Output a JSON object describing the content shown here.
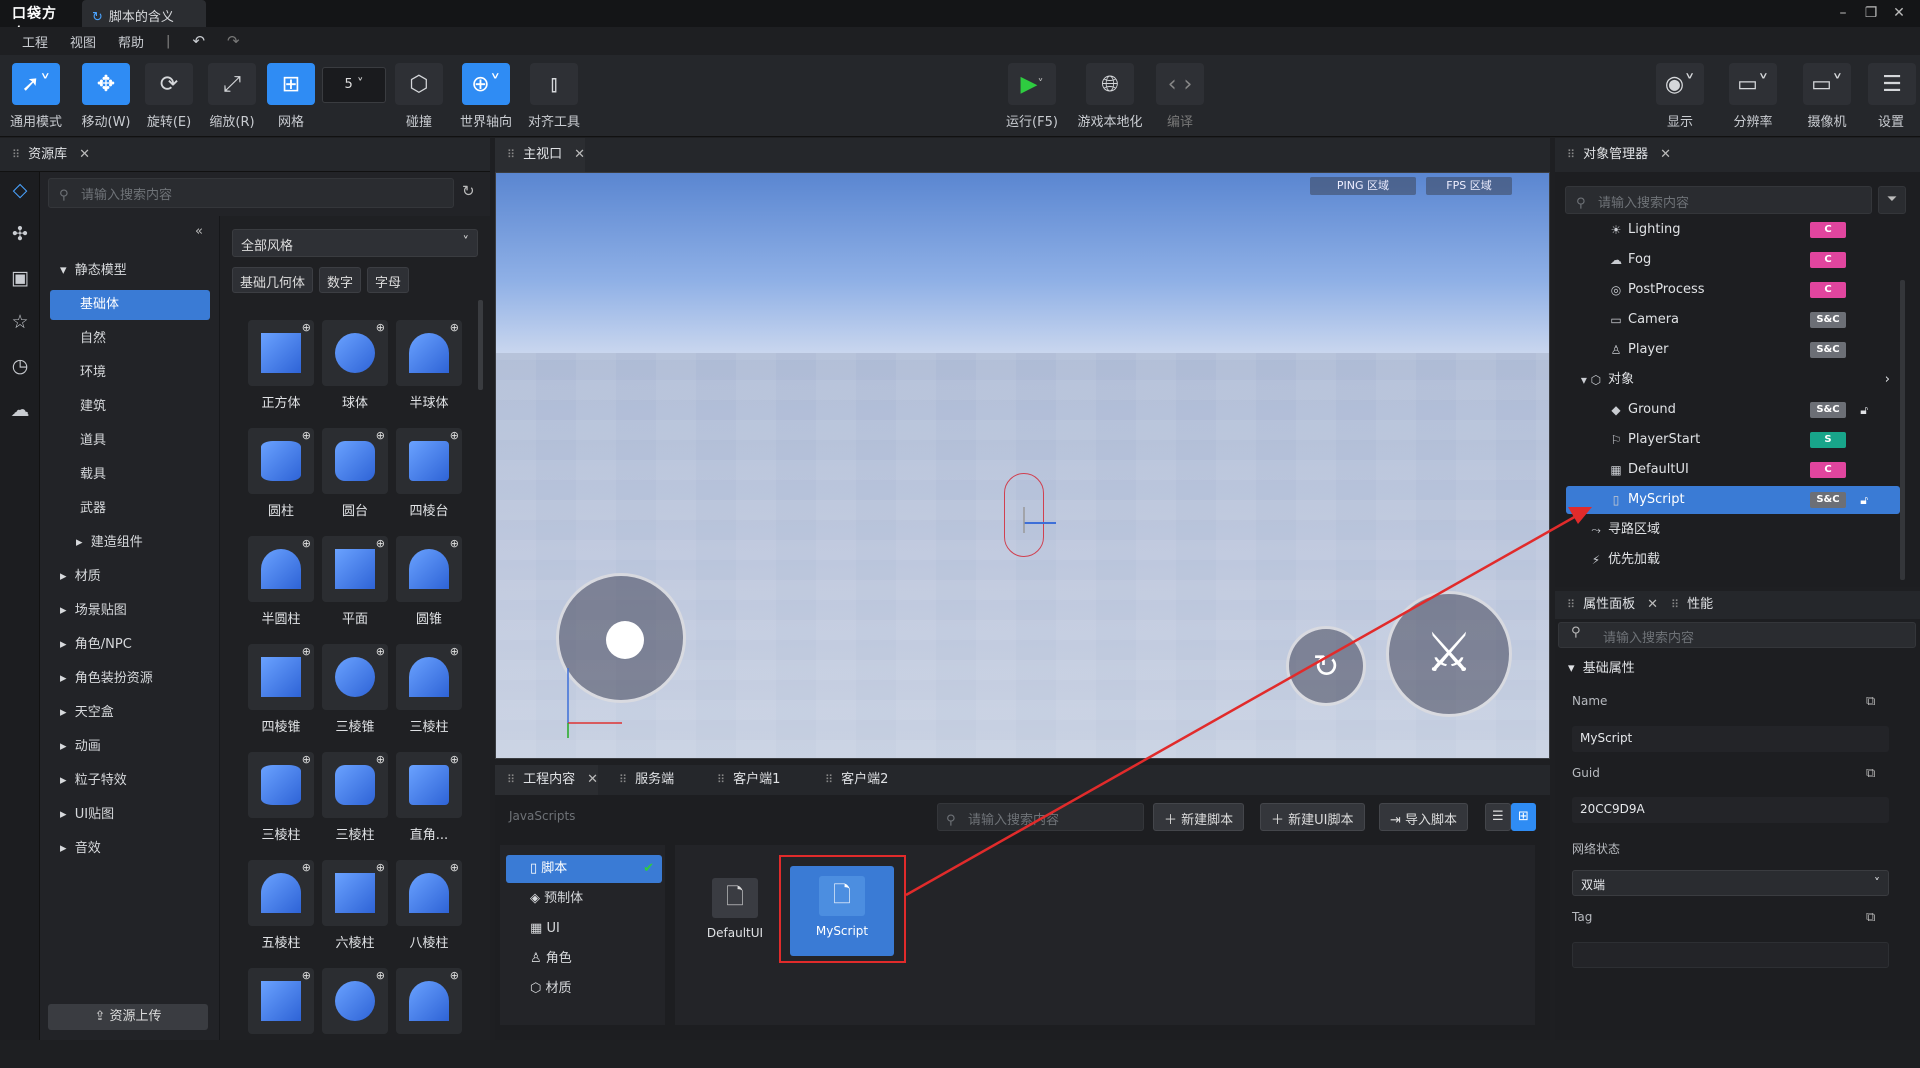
{
  "titlebar": {
    "logo": "口袋方舟",
    "tab_title": "脚本的含义"
  },
  "menu": [
    "工程",
    "视图",
    "帮助"
  ],
  "toolbar": {
    "left": [
      {
        "label": "通用模式"
      },
      {
        "label": "移动(W)"
      },
      {
        "label": "旋转(E)"
      },
      {
        "label": "缩放(R)"
      },
      {
        "label": "网格"
      },
      {
        "label": "碰撞"
      },
      {
        "label": "世界轴向"
      },
      {
        "label": "对齐工具"
      }
    ],
    "grid_size": "5",
    "center": [
      {
        "label": "运行(F5)"
      },
      {
        "label": "游戏本地化"
      },
      {
        "label": "编译"
      }
    ],
    "right": [
      {
        "label": "显示"
      },
      {
        "label": "分辨率"
      },
      {
        "label": "摄像机"
      },
      {
        "label": "设置"
      }
    ]
  },
  "asset_panel": {
    "tab": "资源库",
    "search_placeholder": "请输入搜索内容",
    "tree": [
      "静态模型",
      "基础体",
      "自然",
      "环境",
      "建筑",
      "道具",
      "载具",
      "武器",
      "建造组件",
      "材质",
      "场景贴图",
      "角色/NPC",
      "角色装扮资源",
      "天空盒",
      "动画",
      "粒子特效",
      "UI贴图",
      "音效"
    ],
    "style_filter": "全部风格",
    "chips": [
      "基础几何体",
      "数字",
      "字母"
    ],
    "tiles": [
      "正方体",
      "球体",
      "半球体",
      "圆柱",
      "圆台",
      "四棱台",
      "半圆柱",
      "平面",
      "圆锥",
      "四棱锥",
      "三棱锥",
      "三棱柱",
      "三棱柱",
      "三棱柱",
      "直角...",
      "五棱柱",
      "六棱柱",
      "八棱柱",
      "",
      "",
      ""
    ],
    "upload": "资源上传"
  },
  "viewport": {
    "tab": "主视口",
    "ping": "PING 区域",
    "fps": "FPS 区域"
  },
  "project": {
    "tabs": [
      "工程内容",
      "服务端",
      "客户端1",
      "客户端2"
    ],
    "breadcrumb": "JavaScripts",
    "search_placeholder": "请输入搜索内容",
    "buttons": [
      "新建脚本",
      "新建UI脚本",
      "导入脚本"
    ],
    "tree": [
      "脚本",
      "预制体",
      "UI",
      "角色",
      "材质"
    ],
    "files": [
      "DefaultUI",
      "MyScript"
    ]
  },
  "object_manager": {
    "tab": "对象管理器",
    "search_placeholder": "请输入搜索内容",
    "rows": [
      {
        "name": "Lighting",
        "tag": "C"
      },
      {
        "name": "Fog",
        "tag": "C"
      },
      {
        "name": "PostProcess",
        "tag": "C"
      },
      {
        "name": "Camera",
        "tag": "S&C"
      },
      {
        "name": "Player",
        "tag": "S&C"
      },
      {
        "name": "对象",
        "tag": ""
      },
      {
        "name": "Ground",
        "tag": "S&C"
      },
      {
        "name": "PlayerStart",
        "tag": "S"
      },
      {
        "name": "DefaultUI",
        "tag": "C"
      },
      {
        "name": "MyScript",
        "tag": "S&C"
      },
      {
        "name": "寻路区域",
        "tag": ""
      },
      {
        "name": "优先加载",
        "tag": ""
      }
    ]
  },
  "properties": {
    "tabs": [
      "属性面板",
      "性能"
    ],
    "search_placeholder": "请输入搜索内容",
    "section": "基础属性",
    "name_label": "Name",
    "name_value": "MyScript",
    "guid_label": "Guid",
    "guid_value": "20CC9D9A",
    "net_label": "网络状态",
    "net_value": "双端",
    "tag_label": "Tag",
    "tag_value": ""
  },
  "colors": {
    "accent": "#2f8cf4",
    "highlight": "#e12b2b",
    "tag_c": "#e0459e",
    "tag_s": "#18a58a",
    "tag_sc": "#6c6f76"
  }
}
